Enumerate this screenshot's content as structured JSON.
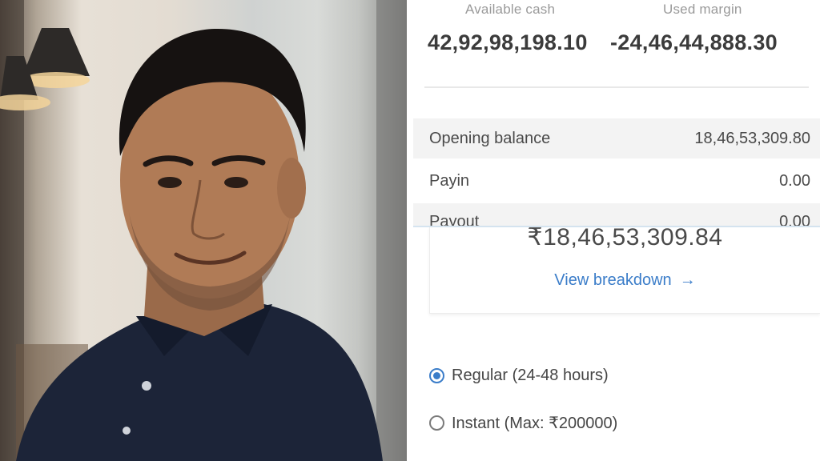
{
  "summary": {
    "available_cash_label": "Available cash",
    "available_cash_value": "42,92,98,198.10",
    "used_margin_label": "Used margin",
    "used_margin_value": "-24,46,44,888.30"
  },
  "ledger": [
    {
      "label": "Opening balance",
      "value": "18,46,53,309.80"
    },
    {
      "label": "Payin",
      "value": "0.00"
    },
    {
      "label": "Payout",
      "value": "0.00"
    }
  ],
  "withdrawal_card": {
    "amount": "₹18,46,53,309.84",
    "link_label": "View breakdown",
    "link_arrow": "→"
  },
  "withdrawal_modes": [
    {
      "label": "Regular (24-48 hours)",
      "selected": true
    },
    {
      "label": "Instant (Max: ₹200000)",
      "selected": false
    }
  ],
  "colors": {
    "accent": "#3b7dc9",
    "shirt": "#1c2438"
  }
}
